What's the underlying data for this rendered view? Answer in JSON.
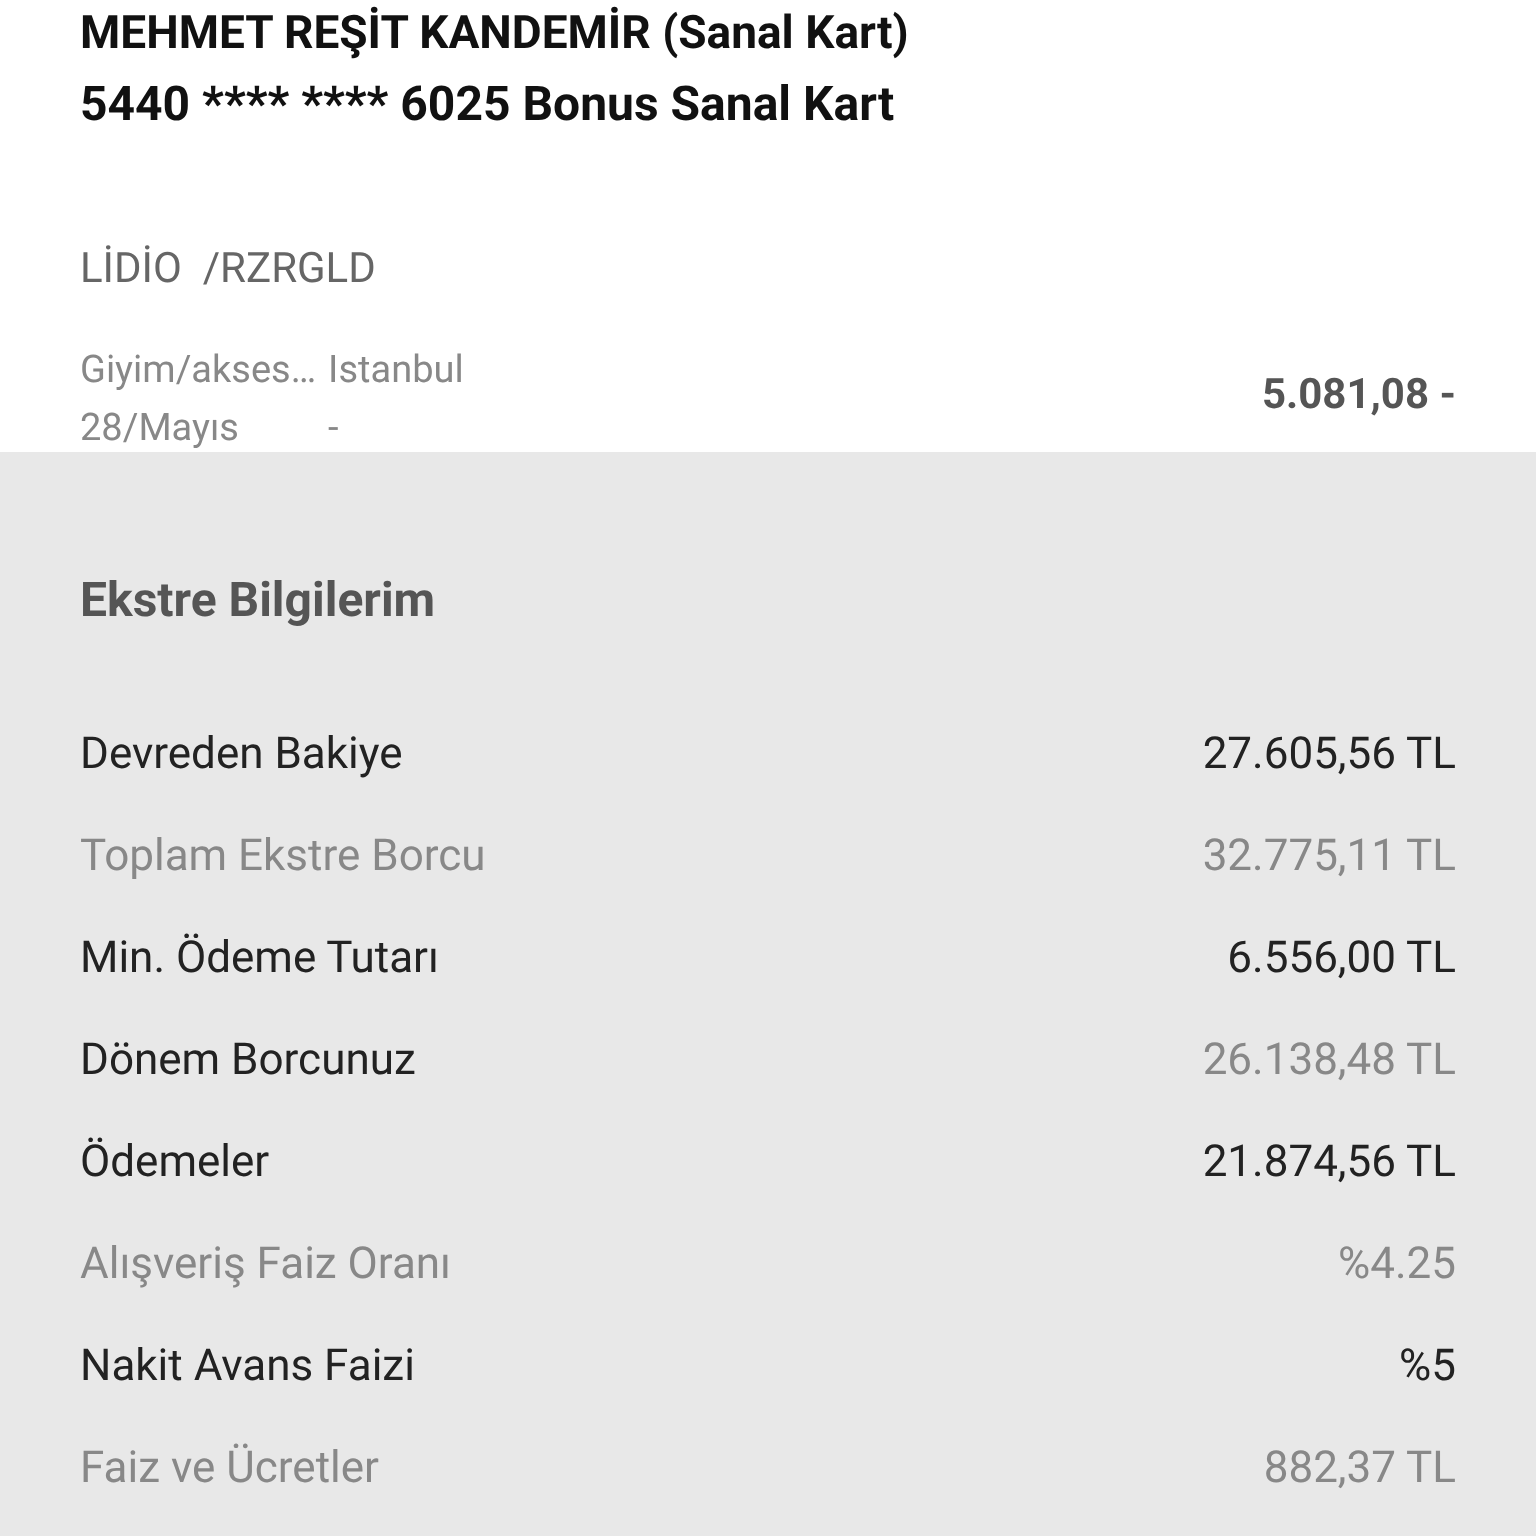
{
  "card": {
    "holder": "MEHMET REŞİT KANDEMİR (Sanal Kart)",
    "number": "5440 **** **** 6025 Bonus Sanal Kart"
  },
  "transaction": {
    "merchant": "LİDİO  /RZRGLD",
    "category": "Giyim/akses…",
    "city": "Istanbul",
    "date": "28/Mayıs",
    "dash": "-",
    "amount": "5.081,08 -"
  },
  "statement": {
    "title": "Ekstre Bilgilerim",
    "rows": [
      {
        "label": "Devreden Bakiye",
        "value": "27.605,56 TL",
        "muted": false
      },
      {
        "label": "Toplam Ekstre Borcu",
        "value": "32.775,11 TL",
        "muted": true
      },
      {
        "label": "Min. Ödeme Tutarı",
        "value": "6.556,00 TL",
        "muted": false
      },
      {
        "label": "Dönem Borcunuz",
        "value": "26.138,48 TL",
        "muted": true,
        "label_muted": false
      },
      {
        "label": "Ödemeler",
        "value": "21.874,56 TL",
        "muted": false
      },
      {
        "label": "Alışveriş Faiz Oranı",
        "value": "%4.25",
        "muted": true
      },
      {
        "label": "Nakit Avans Faizi",
        "value": "%5",
        "muted": false
      },
      {
        "label": "Faiz ve Ücretler",
        "value": "882,37 TL",
        "muted": true
      }
    ]
  }
}
